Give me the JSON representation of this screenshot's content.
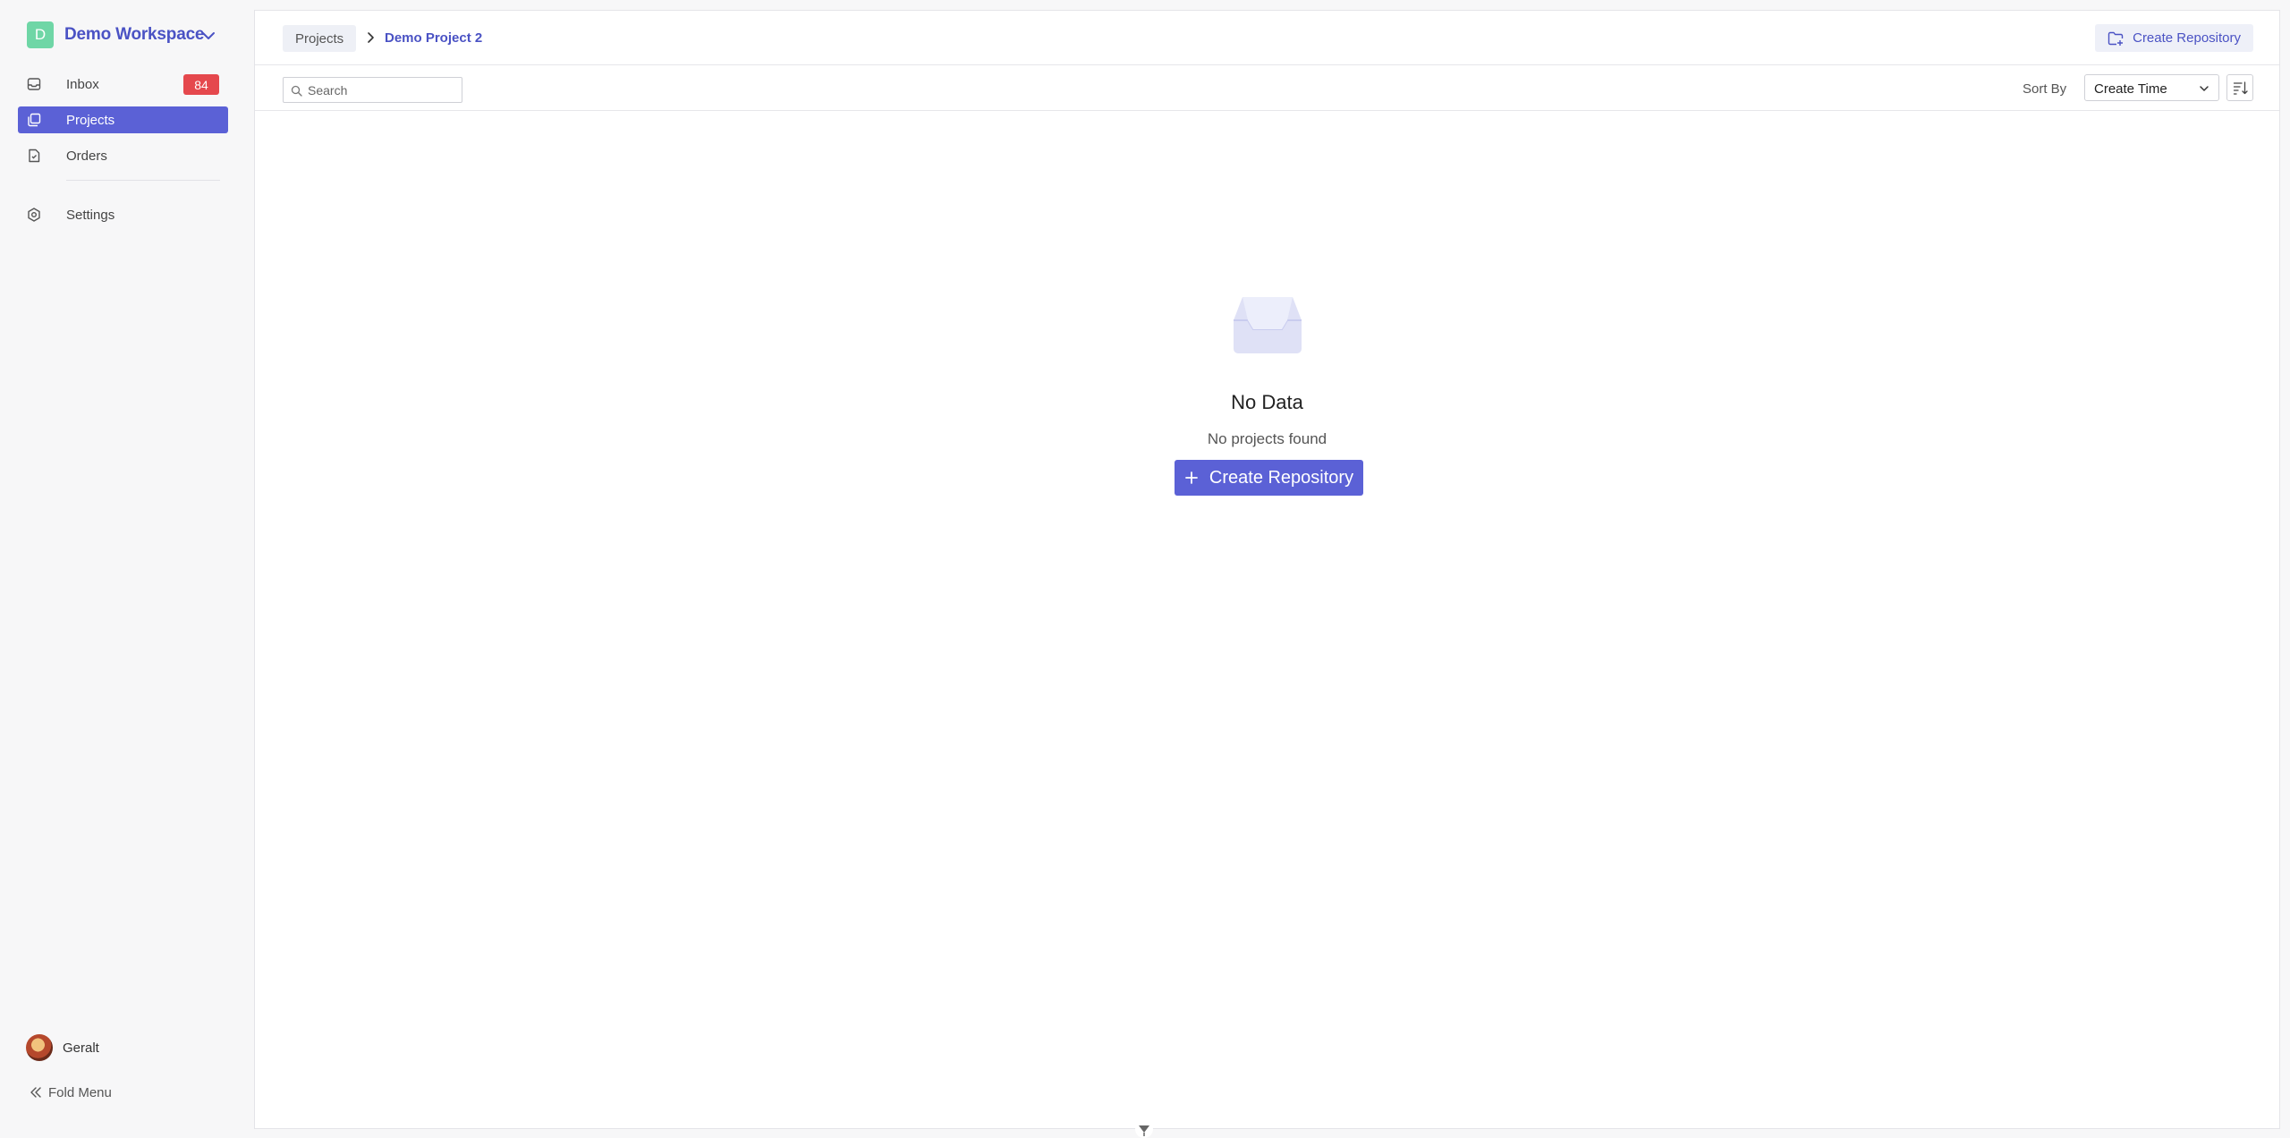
{
  "workspace": {
    "initial": "D",
    "name": "Demo Workspace",
    "avatar_color": "#6fd6a6"
  },
  "sidebar": {
    "items": [
      {
        "label": "Inbox",
        "icon": "inbox-icon",
        "badge": "84"
      },
      {
        "label": "Projects",
        "icon": "projects-icon",
        "active": true
      },
      {
        "label": "Orders",
        "icon": "orders-icon"
      },
      {
        "label": "Settings",
        "icon": "settings-icon"
      }
    ]
  },
  "user": {
    "name": "Geralt"
  },
  "fold_menu": {
    "label": "Fold Menu"
  },
  "breadcrumb": {
    "root": "Projects",
    "current": "Demo Project 2"
  },
  "header": {
    "create_label": "Create Repository"
  },
  "toolbar": {
    "search_placeholder": "Search",
    "sort_label": "Sort By",
    "sort_value": "Create Time"
  },
  "empty_state": {
    "title": "No Data",
    "subtitle": "No projects found",
    "button_label": "Create Repository"
  },
  "colors": {
    "accent": "#5b61d6",
    "accent_text": "#4a52c4",
    "badge": "#e5484d"
  }
}
